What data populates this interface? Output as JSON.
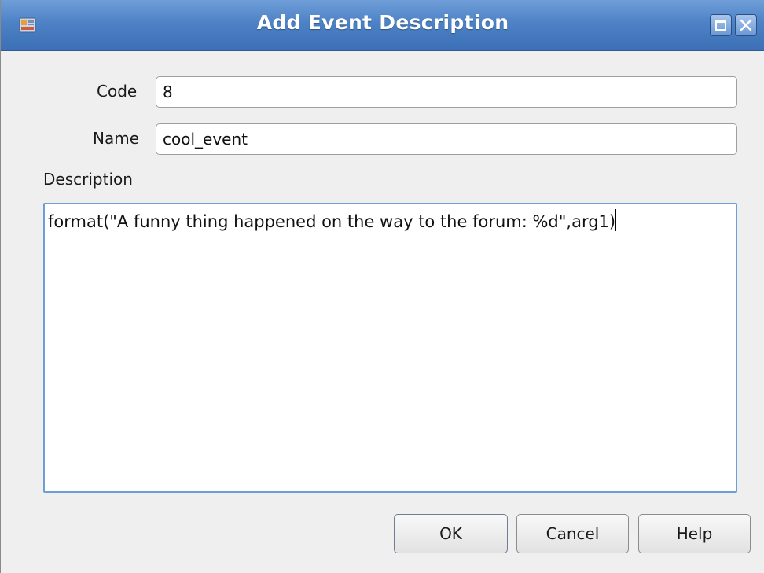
{
  "window": {
    "title": "Add Event Description",
    "title_bar_color": "#4d82c6",
    "icons": {
      "app": "app-icon",
      "maximize": "maximize-icon",
      "close": "close-icon"
    }
  },
  "form": {
    "code": {
      "label": "Code",
      "value": "8"
    },
    "name": {
      "label": "Name",
      "value": "cool_event"
    },
    "description": {
      "label": "Description",
      "value": "format(\"A funny thing happened on the way to the forum: %d\",arg1)"
    }
  },
  "buttons": {
    "ok": "OK",
    "cancel": "Cancel",
    "help": "Help"
  }
}
